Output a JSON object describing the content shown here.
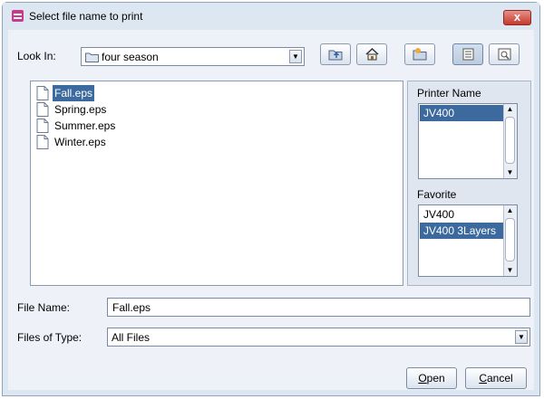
{
  "window": {
    "title": "Select file name to print",
    "close_label": "x"
  },
  "lookin": {
    "label": "Look In:",
    "value": "four season"
  },
  "toolbar": {
    "icons": [
      "up-folder-icon",
      "home-icon",
      "new-folder-icon",
      "list-view-icon",
      "details-view-icon"
    ]
  },
  "files": [
    {
      "name": "Fall.eps",
      "selected": true
    },
    {
      "name": "Spring.eps",
      "selected": false
    },
    {
      "name": "Summer.eps",
      "selected": false
    },
    {
      "name": "Winter.eps",
      "selected": false
    }
  ],
  "printer": {
    "label": "Printer Name",
    "items": [
      "JV400"
    ],
    "selected_index": 0
  },
  "favorite": {
    "label": "Favorite",
    "items": [
      "JV400",
      "JV400 3Layers"
    ],
    "selected_index": 1
  },
  "filename": {
    "label": "File Name:",
    "value": "Fall.eps"
  },
  "filetype": {
    "label": "Files of Type:",
    "value": "All Files"
  },
  "buttons": {
    "open_mnemonic": "O",
    "open_rest": "pen",
    "cancel_mnemonic": "C",
    "cancel_rest": "ancel"
  },
  "colors": {
    "selection": "#3d6a9e",
    "close": "#c7392b",
    "frame": "#dde7f2"
  }
}
